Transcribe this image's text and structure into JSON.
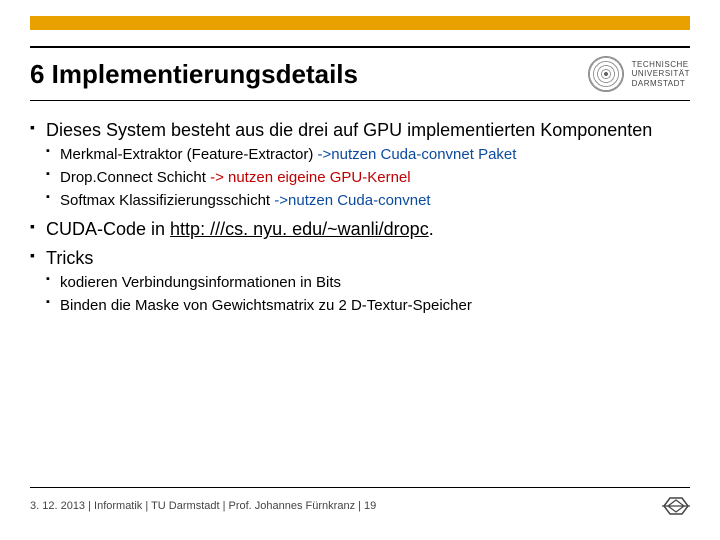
{
  "header": {
    "title": "6 Implementierungsdetails",
    "university": "TECHNISCHE\nUNIVERSITÄT\nDARMSTADT"
  },
  "bullets": {
    "b1": "Dieses System besteht aus die drei auf GPU implementierten Komponenten",
    "b1_children": {
      "c1_black": "Merkmal-Extraktor (Feature-Extractor) ",
      "c1_blue": "->nutzen Cuda-convnet Paket",
      "c2_black": "Drop.Connect Schicht ",
      "c2_red": "-> nutzen eigeine GPU-Kernel",
      "c3_black": "Softmax Klassifizierungsschicht ",
      "c3_blue": "->nutzen Cuda-convnet"
    },
    "b2_pre": "CUDA-Code in ",
    "b2_link": "http: ///cs. nyu. edu/~wanli/dropc",
    "b2_post": ".",
    "b3": "Tricks",
    "b3_children": {
      "c1": "kodieren Verbindungsinformationen in Bits",
      "c2": "Binden die Maske von Gewichtsmatrix zu 2 D-Textur-Speicher"
    }
  },
  "footer": {
    "text": "3. 12. 2013  |  Informatik  |  TU Darmstadt  | Prof. Johannes Fürnkranz |  19"
  }
}
